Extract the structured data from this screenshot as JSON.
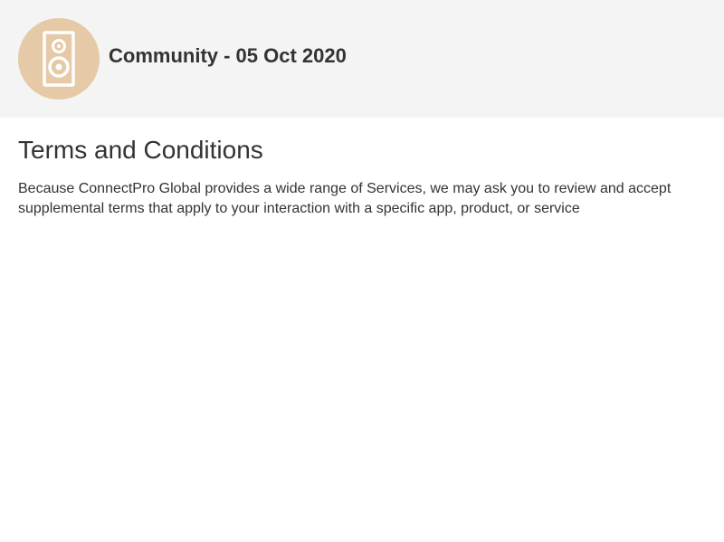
{
  "header": {
    "title": "Community - 05 Oct 2020",
    "avatar_icon": "speaker-icon",
    "avatar_color": "#e6c9a6"
  },
  "main": {
    "title": "Terms and Conditions",
    "paragraph": "Because ConnectPro Global provides a wide range of Services, we may ask you to review and accept supplemental terms that apply to your interaction with a specific app, product, or service"
  }
}
